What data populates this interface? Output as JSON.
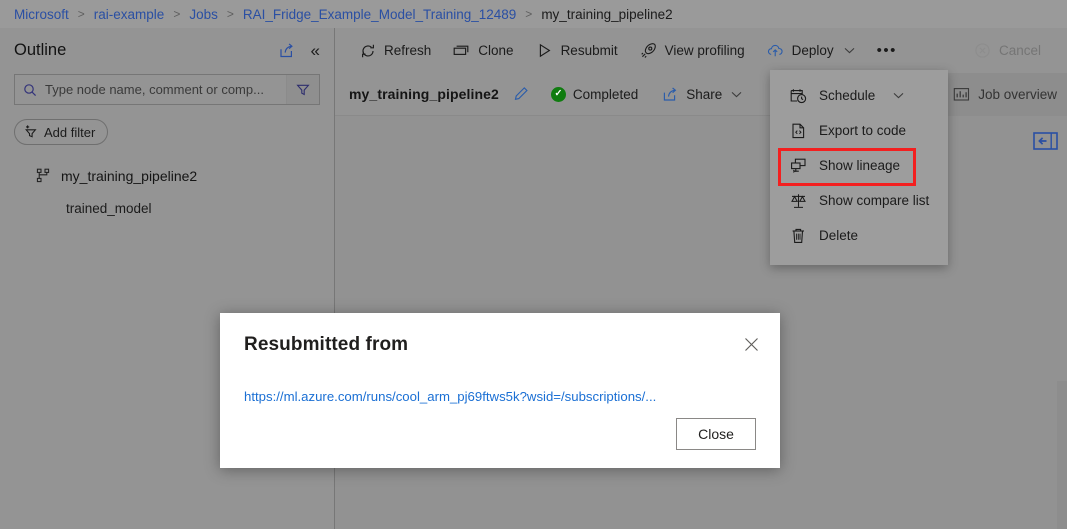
{
  "breadcrumb": {
    "items": [
      {
        "label": "Microsoft",
        "link": true
      },
      {
        "label": "rai-example",
        "link": true
      },
      {
        "label": "Jobs",
        "link": true
      },
      {
        "label": "RAI_Fridge_Example_Model_Training_12489",
        "link": true
      },
      {
        "label": "my_training_pipeline2",
        "link": false
      }
    ],
    "separator": ">"
  },
  "toolbar": {
    "refresh_label": "Refresh",
    "clone_label": "Clone",
    "resubmit_label": "Resubmit",
    "view_profiling_label": "View profiling",
    "deploy_label": "Deploy",
    "deploy_chevron": "⌄",
    "more_label": "•••",
    "cancel_label": "Cancel"
  },
  "subbar": {
    "pipeline_name": "my_training_pipeline2",
    "status_label": "Completed",
    "status_color": "#107c10",
    "share_label": "Share",
    "share_chevron": "⌄",
    "job_overview_label": "Job overview"
  },
  "sidebar": {
    "title": "Outline",
    "search": {
      "placeholder": "Type node name, comment or comp...",
      "value": ""
    },
    "add_filter_label": "Add filter",
    "tree": {
      "root_label": "my_training_pipeline2",
      "children": [
        {
          "label": "trained_model"
        }
      ]
    }
  },
  "menu": {
    "items": [
      {
        "label": "Schedule",
        "icon": "schedule-icon",
        "chevron": "⌄",
        "highlighted": false
      },
      {
        "label": "Export to code",
        "icon": "export-code-icon",
        "chevron": "",
        "highlighted": false
      },
      {
        "label": "Show lineage",
        "icon": "lineage-icon",
        "chevron": "",
        "highlighted": true
      },
      {
        "label": "Show compare list",
        "icon": "compare-icon",
        "chevron": "",
        "highlighted": false
      },
      {
        "label": "Delete",
        "icon": "trash-icon",
        "chevron": "",
        "highlighted": false
      }
    ],
    "highlight_color": "#f31f1f"
  },
  "dialog": {
    "title": "Resubmitted from",
    "link_text": "https://ml.azure.com/runs/cool_arm_pj69ftws5k?wsid=/subscriptions/...",
    "close_button_label": "Close",
    "close_icon": "✕"
  },
  "colors": {
    "accent_link": "#2a4fa3",
    "dialog_link": "#1a6fd4",
    "status_success": "#107c10",
    "highlight_red": "#f31f1f",
    "canvas_bg": "#929292"
  }
}
